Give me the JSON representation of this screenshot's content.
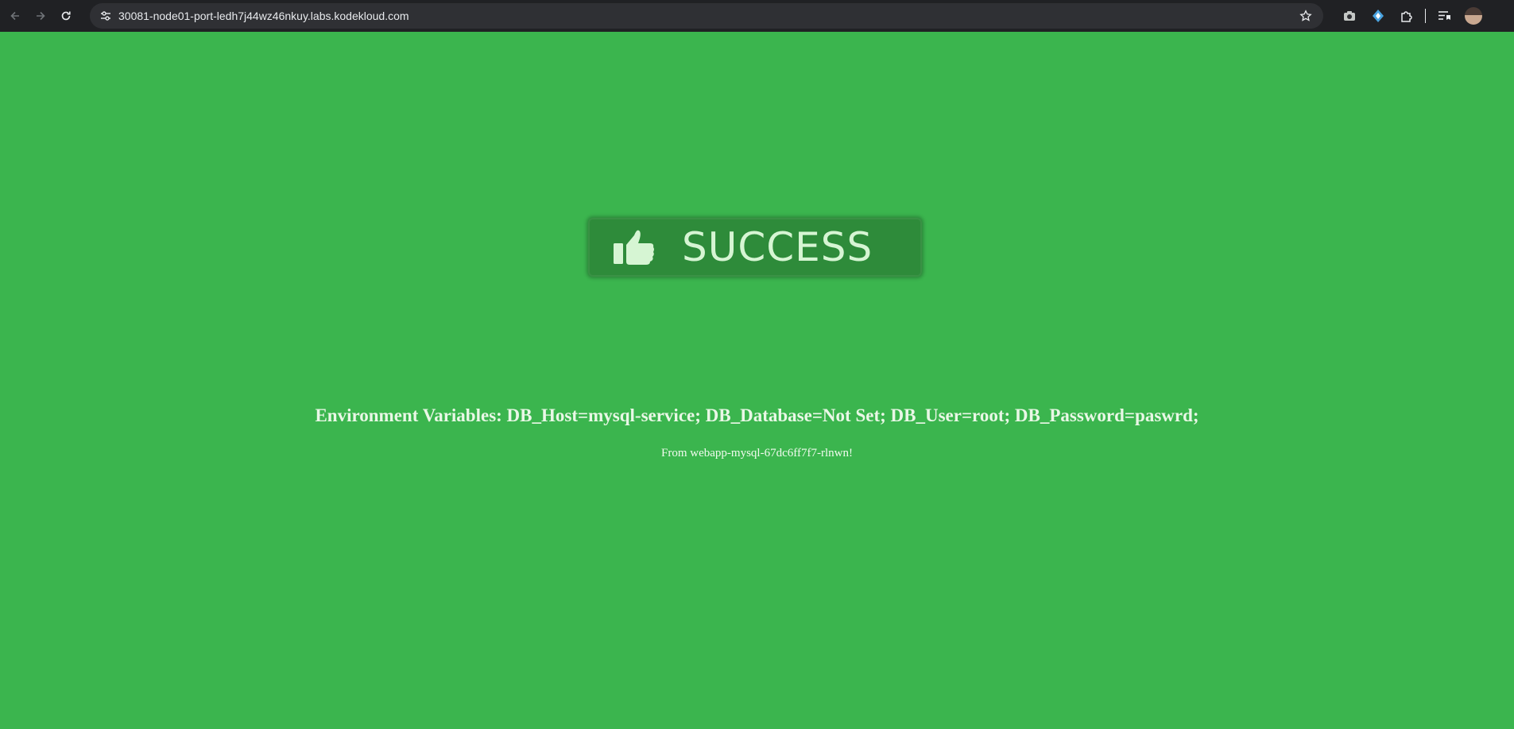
{
  "browser": {
    "url": "30081-node01-port-ledh7j44wz46nkuy.labs.kodekloud.com",
    "icons": [
      "back-arrow-icon",
      "forward-arrow-icon",
      "reload-icon",
      "site-info-icon",
      "bookmark-star-icon",
      "camera-icon",
      "extension-puzzle-icon",
      "reading-list-icon",
      "avatar"
    ]
  },
  "page": {
    "badge_label": "SUCCESS",
    "env_text": "Environment Variables: DB_Host=mysql-service; DB_Database=Not Set; DB_User=root; DB_Password=paswrd;",
    "from_text": "From webapp-mysql-67dc6ff7f7-rlnwn!"
  },
  "colors": {
    "background": "#3bb54e",
    "badge": "#2e8b3a",
    "badge_text": "#d6f5d3",
    "browser_bar": "#202124"
  }
}
